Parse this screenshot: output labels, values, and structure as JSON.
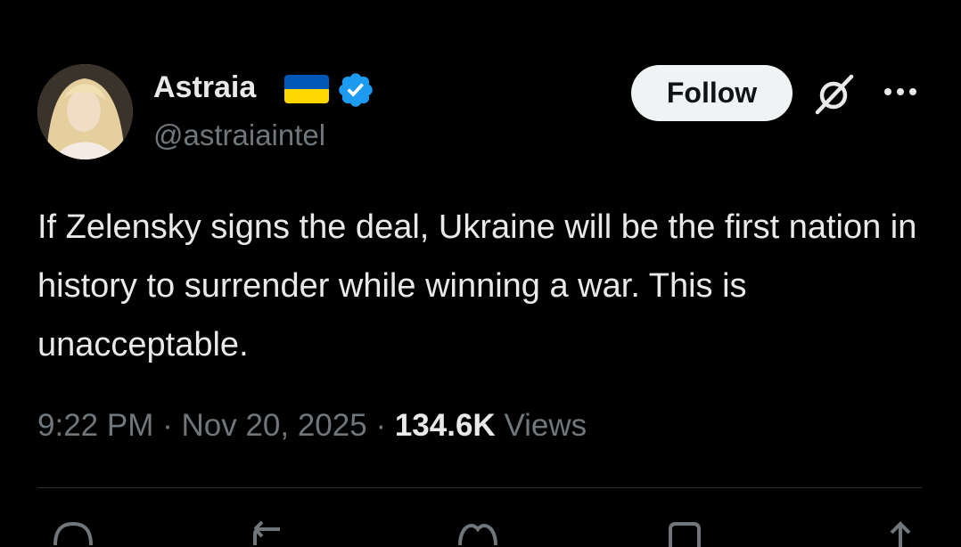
{
  "author": {
    "display_name": "Astraia",
    "handle": "@astraiaintel",
    "flag_colors": [
      "#0057b7",
      "#ffd700"
    ],
    "verified_color": "#1d9bf0"
  },
  "header": {
    "follow_label": "Follow"
  },
  "tweet": {
    "text": "If Zelensky signs the deal, Ukraine will be the first nation in history to surrender while winning a war. This is unacceptable.",
    "time": "9:22 PM",
    "date": "Nov 20, 2025",
    "separator": "·",
    "views_count": "134.6K",
    "views_label": "Views"
  },
  "actions": [
    "reply-icon",
    "repost-icon",
    "like-icon",
    "bookmark-icon",
    "share-icon"
  ],
  "theme": {
    "background": "#000000",
    "text": "#e7e9ea",
    "secondary_text": "#71767b",
    "button_bg": "#eff3f4"
  }
}
